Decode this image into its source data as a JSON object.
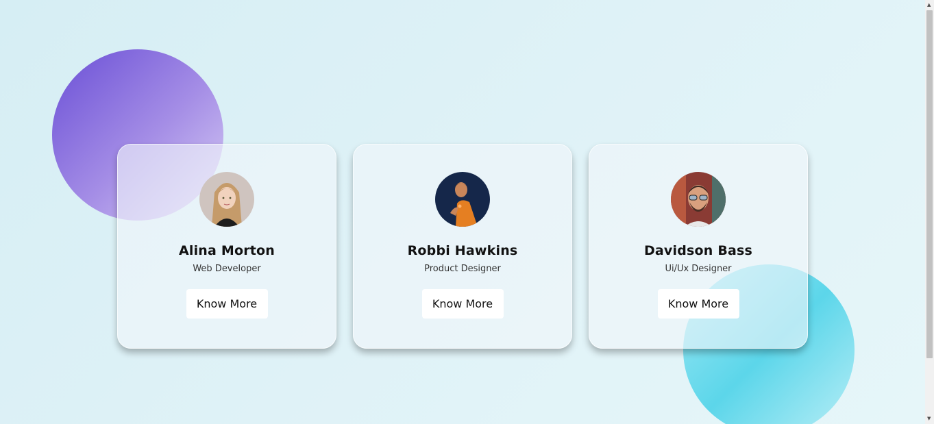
{
  "cards": [
    {
      "name": "Alina Morton",
      "role": "Web Developer",
      "button": "Know More",
      "avatar_icon": "woman-portrait-avatar"
    },
    {
      "name": "Robbi Hawkins",
      "role": "Product Designer",
      "button": "Know More",
      "avatar_icon": "man-portrait-avatar"
    },
    {
      "name": "Davidson Bass",
      "role": "Ui/Ux Designer",
      "button": "Know More",
      "avatar_icon": "man-sunglasses-avatar"
    }
  ],
  "colors": {
    "background": "#dbf0f5",
    "purple_blob": "#6a4fd6",
    "cyan_blob": "#5cd6ea",
    "button_bg": "#ffffff"
  },
  "scrollbar": {
    "up_icon": "▲",
    "down_icon": "▼"
  }
}
